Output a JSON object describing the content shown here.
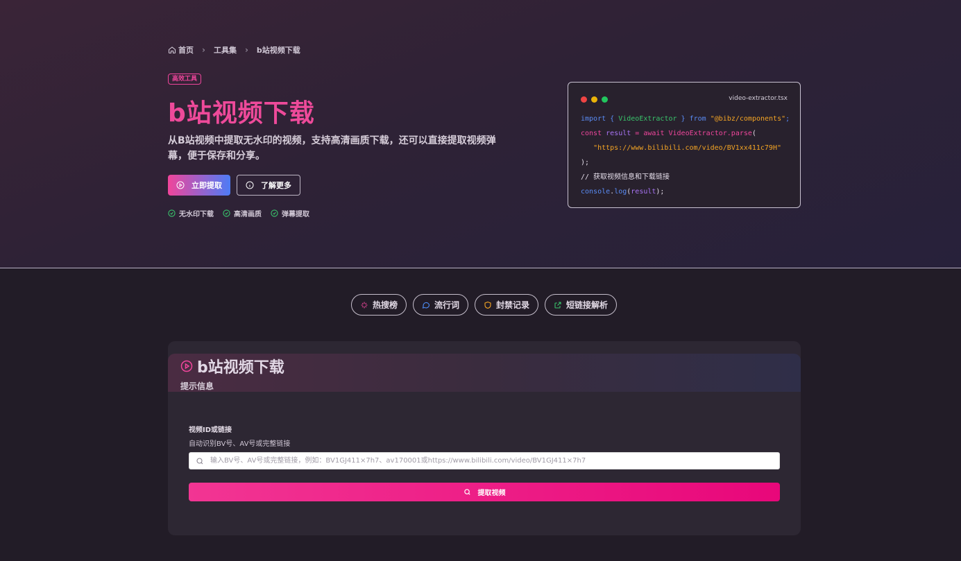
{
  "breadcrumb": {
    "home": "首页",
    "tools": "工具集",
    "current": "b站视频下载"
  },
  "hero": {
    "badge": "高效工具",
    "title": "b站视频下载",
    "description": "从B站视频中提取无水印的视频，支持高清画质下载，还可以直接提取视频弹幕，便于保存和分享。",
    "primary_button": "立即提取",
    "secondary_button": "了解更多",
    "features": [
      "无水印下载",
      "高清画质",
      "弹幕提取"
    ]
  },
  "code_card": {
    "filename": "video-extractor.tsx",
    "line1": {
      "import": "import",
      "brace_open": "{",
      "name": "VideoExtractor",
      "brace_close": "}",
      "from": "from",
      "module": "\"@bibz/components\"",
      "semi": ";"
    },
    "line2": {
      "const": "const",
      "var": "result",
      "eq": "=",
      "await": "await",
      "call": "VideoExtractor.parse",
      "paren": "("
    },
    "line3": "\"https://www.bilibili.com/video/BV1xx411c79H\"",
    "line4": ");",
    "line5": "// 获取视频信息和下载链接",
    "line6": {
      "obj": "console",
      "dot": ".",
      "method": "log",
      "open": "(",
      "arg": "result",
      "close": ");"
    }
  },
  "tools_nav": [
    {
      "label": "热搜榜",
      "icon": "sparkle-icon",
      "color": "#f0469c"
    },
    {
      "label": "流行词",
      "icon": "chat-icon",
      "color": "#4d8cf5"
    },
    {
      "label": "封禁记录",
      "icon": "shield-icon",
      "color": "#f5a524"
    },
    {
      "label": "短链接解析",
      "icon": "external-link-icon",
      "color": "#39c46b"
    }
  ],
  "panel": {
    "title": "b站视频下载",
    "subtitle": "提示信息",
    "field_label": "视频ID或链接",
    "field_help": "自动识别BV号、AV号或完整链接",
    "input_placeholder": "输入BV号、AV号或完整链接，例如：BV1GJ411×7h7、av170001或https://www.bilibili.com/video/BV1GJ411×7h7",
    "input_value": "",
    "submit_label": "提取视频"
  },
  "colors": {
    "accent_pink": "#f0469c",
    "accent_blue": "#4d7cf6",
    "check_green": "#39c46b"
  }
}
